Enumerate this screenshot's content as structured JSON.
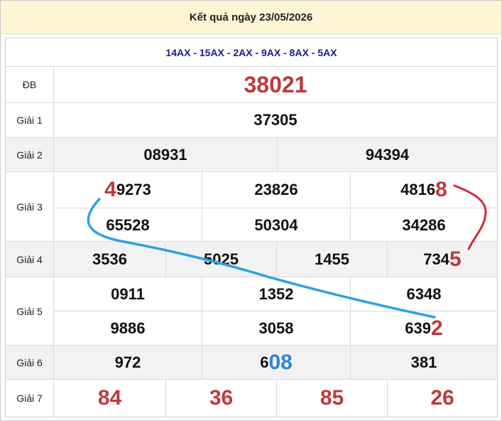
{
  "header": {
    "title": "Kết quả ngày 23/05/2026"
  },
  "codes": "14AX - 15AX - 2AX - 9AX - 8AX - 5AX",
  "rows": {
    "db": {
      "label": "ĐB",
      "value": "38021"
    },
    "g1": {
      "label": "Giải 1",
      "value": "37305"
    },
    "g2": {
      "label": "Giải 2",
      "values": [
        "08931",
        "94394"
      ]
    },
    "g3": {
      "label": "Giải 3",
      "top": [
        {
          "hl": "4",
          "rest": "9273"
        },
        {
          "plain": "23826"
        },
        {
          "rest": "4816",
          "hl": "8"
        }
      ],
      "bottom": [
        "65528",
        "50304",
        "34286"
      ]
    },
    "g4": {
      "label": "Giải 4",
      "values": [
        "3536",
        "5025",
        "1455"
      ],
      "last": {
        "rest": "734",
        "hl": "5"
      }
    },
    "g5": {
      "label": "Giải 5",
      "top": [
        "0911",
        "1352",
        "6348"
      ],
      "bottom": [
        "9886",
        "3058"
      ],
      "last": {
        "rest": "639",
        "hl": "2"
      }
    },
    "g6": {
      "label": "Giải 6",
      "first": "972",
      "mid": {
        "rest": "6",
        "hl": "08"
      },
      "last": "381"
    },
    "g7": {
      "label": "Giải 7",
      "values": [
        "84",
        "36",
        "85",
        "26"
      ]
    }
  },
  "colors": {
    "red": "#c0393b",
    "blue": "#2e86d4",
    "header_bg": "#fdf5d3",
    "codes": "#1a1a8c"
  }
}
